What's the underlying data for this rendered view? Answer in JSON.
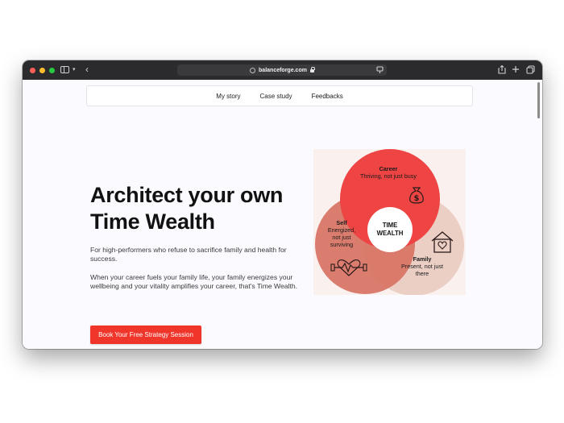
{
  "browser": {
    "url": "balanceforge.com"
  },
  "nav": {
    "items": [
      "My story",
      "Case study",
      "Feedbacks"
    ]
  },
  "hero": {
    "title": "Architect your own Time Wealth",
    "paragraph1": "For high-performers who refuse to sacrifice family and health for success.",
    "paragraph2": "When your career fuels your family life, your family energizes your wellbeing and your vitality amplifies your career, that's Time Wealth.",
    "cta": "Book Your Free Strategy Session"
  },
  "venn": {
    "career_title": "Career",
    "career_sub": "Thriving, not just busy",
    "self_title": "Self",
    "self_sub": "Energized, not just surviving",
    "family_title": "Family",
    "family_sub": "Present, not just there",
    "center_line1": "TIME",
    "center_line2": "WEALTH"
  },
  "colors": {
    "accent": "#f0352b",
    "career": "#ee4544",
    "self": "#d87566",
    "family": "#ebcfc5"
  }
}
